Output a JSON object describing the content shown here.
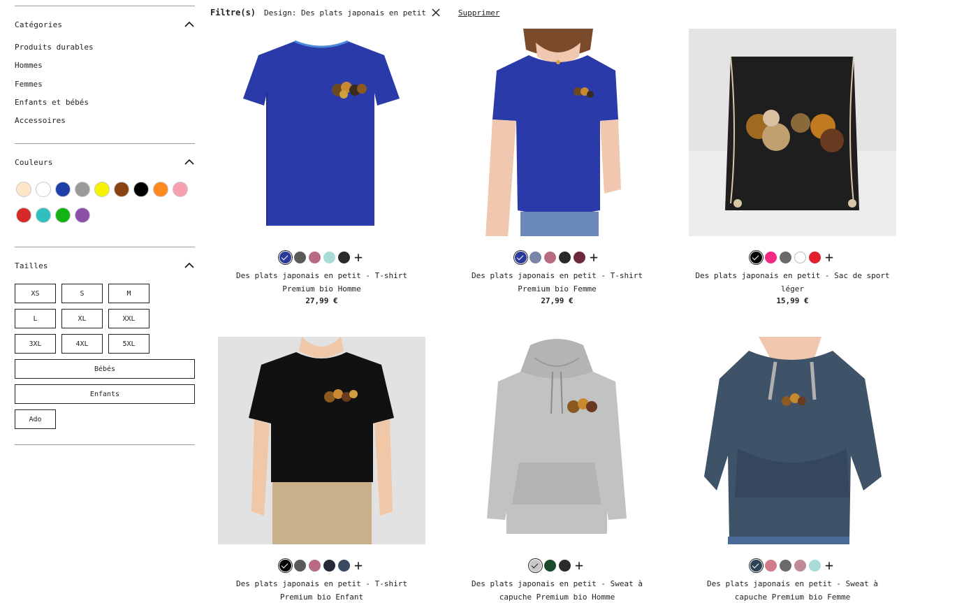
{
  "filter": {
    "label": "Filtre(s)",
    "chip": "Design: Des plats japonais en petit",
    "remove": "Supprimer"
  },
  "sidebar": {
    "categories": {
      "title": "Catégories",
      "items": [
        "Produits durables",
        "Hommes",
        "Femmes",
        "Enfants et bébés",
        "Accessoires"
      ]
    },
    "colors": {
      "title": "Couleurs",
      "swatches": [
        "#fde6c8",
        "#ffffff",
        "#1e3fa8",
        "#9a9a9a",
        "#f7f200",
        "#8a4310",
        "#000000",
        "#ff8a20",
        "#f7a0b0",
        "#d62a2a",
        "#2ec0c0",
        "#12b312",
        "#8c4fa8"
      ]
    },
    "sizes": {
      "title": "Tailles",
      "items": [
        "XS",
        "S",
        "M",
        "L",
        "XL",
        "XXL",
        "3XL",
        "4XL",
        "5XL"
      ],
      "wide": [
        "Bébés",
        "Enfants"
      ],
      "last": "Ado"
    }
  },
  "products": [
    {
      "title": "Des plats japonais en petit - T-shirt Premium bio Homme",
      "price": "27,99 €",
      "swatches": [
        "#2a3a9a",
        "#5a5a5a",
        "#b86a80",
        "#a8dcd8",
        "#2a2a2a"
      ],
      "selected": 0
    },
    {
      "title": "Des plats japonais en petit - T-shirt Premium bio Femme",
      "price": "27,99 €",
      "swatches": [
        "#2a3a9a",
        "#7a86a8",
        "#b86a80",
        "#2a2a2a",
        "#6a2a3a"
      ],
      "selected": 0
    },
    {
      "title": "Des plats japonais en petit - Sac de sport léger",
      "price": "15,99 €",
      "swatches": [
        "#000000",
        "#f22a84",
        "#6a6a6a",
        "#ffffff",
        "#e0202a"
      ],
      "selected": 0
    },
    {
      "title": "Des plats japonais en petit - T-shirt Premium bio Enfant",
      "price": "",
      "swatches": [
        "#000000",
        "#5a5a5a",
        "#b86a80",
        "#252a3a",
        "#3a4a60"
      ],
      "selected": 0
    },
    {
      "title": "Des plats japonais en petit - Sweat à capuche Premium bio Homme",
      "price": "",
      "swatches": [
        "#c8c8c8",
        "#1a4a2a",
        "#2a2a2a"
      ],
      "selected": 0
    },
    {
      "title": "Des plats japonais en petit - Sweat à capuche Premium bio Femme",
      "price": "",
      "swatches": [
        "#2e4258",
        "#d07a8a",
        "#6a6a6a",
        "#c08a98",
        "#a8dcd8"
      ],
      "selected": 0
    }
  ]
}
